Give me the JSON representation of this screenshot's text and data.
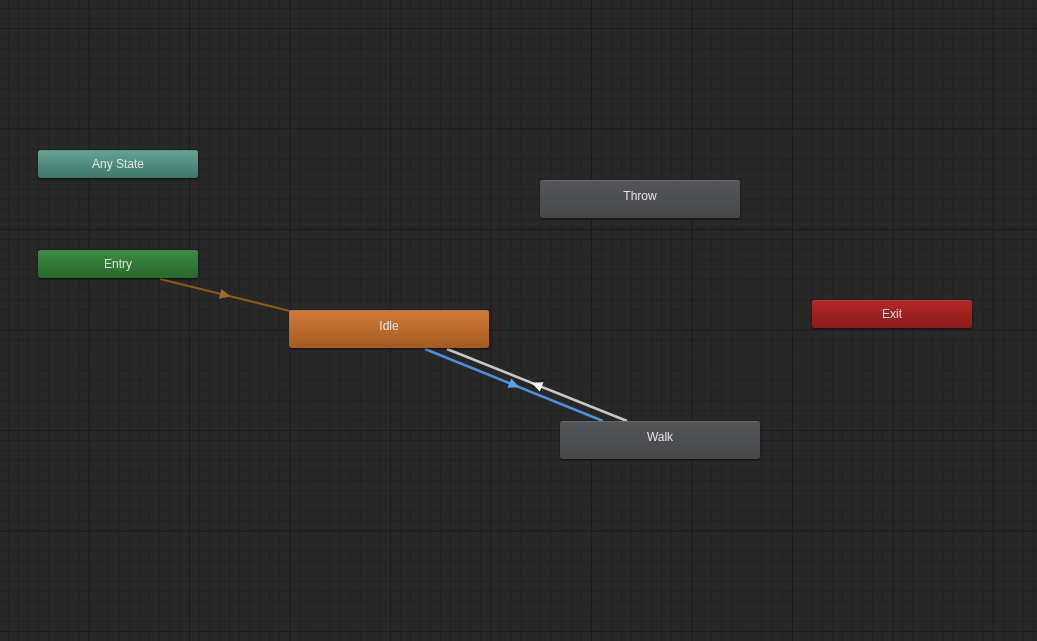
{
  "nodes": [
    {
      "label": "Any State",
      "kind": "any_state"
    },
    {
      "label": "Entry",
      "kind": "entry"
    },
    {
      "label": "Idle",
      "kind": "default"
    },
    {
      "label": "Throw",
      "kind": "state"
    },
    {
      "label": "Walk",
      "kind": "state"
    },
    {
      "label": "Exit",
      "kind": "exit"
    }
  ],
  "transitions": [
    {
      "kind": "entry",
      "selected": false
    },
    {
      "kind": "normal",
      "selected": true
    },
    {
      "kind": "normal",
      "selected": false
    }
  ]
}
